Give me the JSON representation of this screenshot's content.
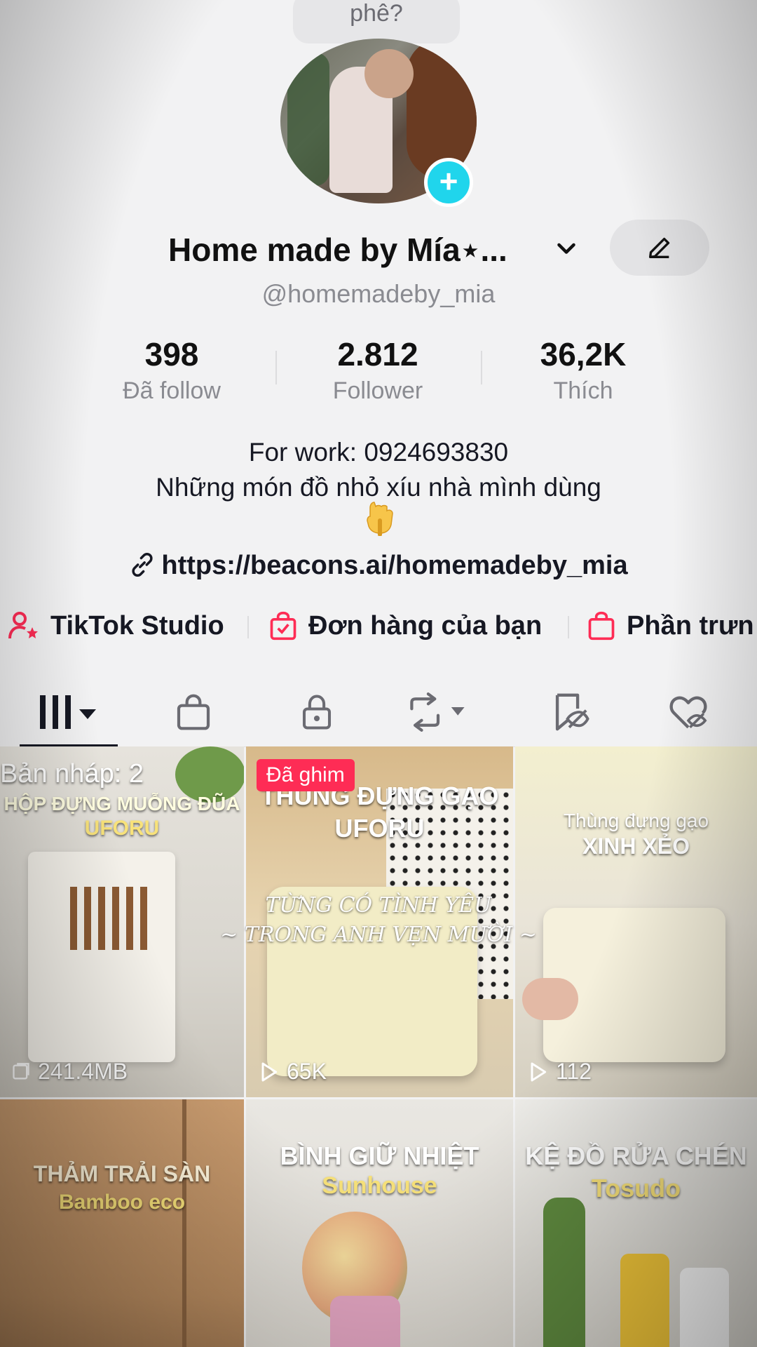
{
  "bubble": {
    "text": "phê?"
  },
  "profile": {
    "name": "Home made by Mía⋆...",
    "handle": "@homemadeby_mia"
  },
  "stats": [
    {
      "value": "398",
      "label": "Đã follow"
    },
    {
      "value": "2.812",
      "label": "Follower"
    },
    {
      "value": "36,2K",
      "label": "Thích"
    }
  ],
  "bio": {
    "line1": "For work: 0924693830",
    "line2": "Những món đồ nhỏ xíu nhà mình dùng"
  },
  "link": {
    "url": "https://beacons.ai/homemadeby_mia"
  },
  "shortcuts": [
    {
      "label": "TikTok Studio"
    },
    {
      "label": "Đơn hàng của bạn"
    },
    {
      "label": "Phần trưn"
    }
  ],
  "colors": {
    "accent": "#fe2c55",
    "follow_btn": "#20d5ec",
    "text": "#161823",
    "secondary": "#8a8b91"
  },
  "videos": [
    {
      "title1": "Bản nháp: 2",
      "title2": "HỘP ĐỰNG MUỖNG ĐŨA",
      "title3": "UFORU",
      "stat": "241.4MB"
    },
    {
      "title1": "THÙNG ĐỰNG GẠO",
      "title2": "UFORU",
      "stat": "65K",
      "badge": "Đã ghim"
    },
    {
      "title1": "Thùng đựng gạo",
      "title2": "XINH XẺO",
      "stat": "112"
    },
    {
      "title1": "THẢM TRẢI SÀN",
      "title2": "Bamboo eco"
    },
    {
      "title1": "BÌNH GIỮ NHIỆT",
      "title2": "Sunhouse"
    },
    {
      "title1": "KỆ ĐỒ RỬA CHÉN",
      "title2": "Tosudo"
    }
  ],
  "lyrics": {
    "line1": "TỪNG CÓ TÌNH YÊU",
    "line2": "~ TRONG ANH VẸN MƯỜI ~"
  }
}
